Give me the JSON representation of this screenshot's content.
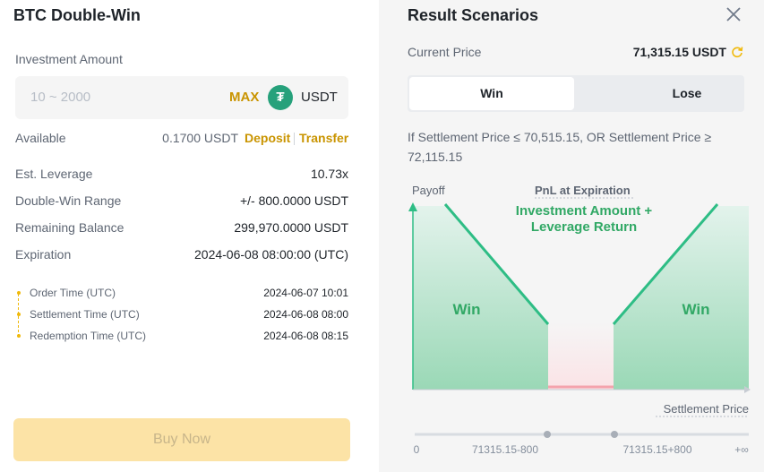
{
  "left": {
    "title": "BTC Double-Win",
    "investment_label": "Investment Amount",
    "amount_placeholder": "10 ~ 2000",
    "max_label": "MAX",
    "currency_icon": "tether-icon",
    "currency": "USDT",
    "available_label": "Available",
    "available_value": "0.1700 USDT",
    "deposit_label": "Deposit",
    "transfer_label": "Transfer",
    "details": [
      {
        "label": "Est. Leverage",
        "value": "10.73x"
      },
      {
        "label": "Double-Win Range",
        "value": "+/- 800.0000 USDT"
      },
      {
        "label": "Remaining Balance",
        "value": "299,970.0000 USDT"
      },
      {
        "label": "Expiration",
        "value": "2024-06-08 08:00:00 (UTC)"
      }
    ],
    "timeline": [
      {
        "label": "Order Time (UTC)",
        "value": "2024-06-07 10:01"
      },
      {
        "label": "Settlement Time (UTC)",
        "value": "2024-06-08 08:00"
      },
      {
        "label": "Redemption Time (UTC)",
        "value": "2024-06-08 08:15"
      }
    ],
    "buy_label": "Buy Now"
  },
  "right": {
    "title": "Result Scenarios",
    "current_price_label": "Current Price",
    "current_price_value": "71,315.15 USDT",
    "tabs": [
      {
        "label": "Win",
        "active": true
      },
      {
        "label": "Lose",
        "active": false
      }
    ],
    "condition": "If Settlement Price ≤ 70,515.15, OR Settlement Price ≥ 72,115.15",
    "chart": {
      "payoff_label": "Payoff",
      "pnl_label": "PnL at Expiration",
      "annotation_line1": "Investment Amount +",
      "annotation_line2": "Leverage Return",
      "win_left": "Win",
      "win_right": "Win",
      "settlement_label": "Settlement Price",
      "ticks": [
        "0",
        "71315.15-800",
        "71315.15+800",
        "+∞"
      ]
    }
  },
  "colors": {
    "accent": "#c99400",
    "win_green": "#2ebd85",
    "win_text": "#31a865",
    "lose_red": "#f6465d"
  }
}
